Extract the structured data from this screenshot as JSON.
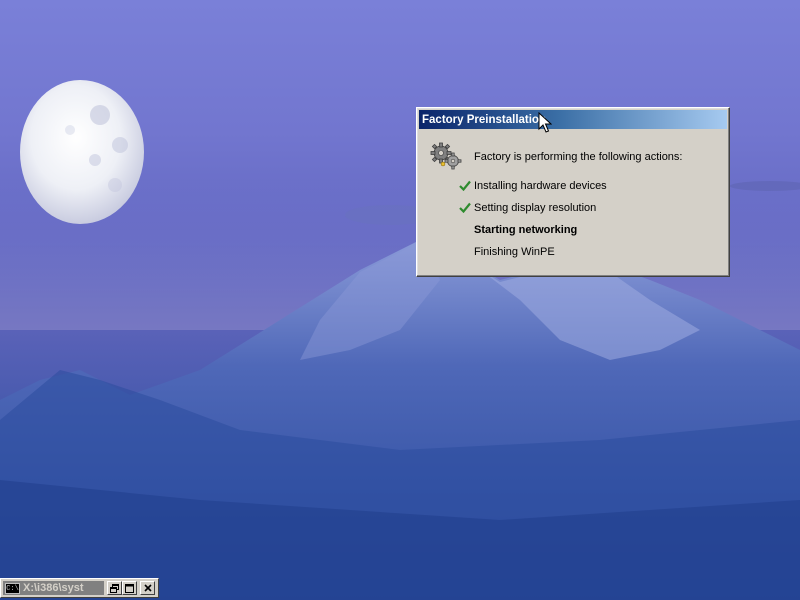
{
  "factory_dialog": {
    "title": "Factory Preinstallation",
    "header": "Factory is performing the following actions:",
    "actions": [
      {
        "label": "Installing hardware devices",
        "status": "done"
      },
      {
        "label": "Setting display resolution",
        "status": "done"
      },
      {
        "label": "Starting networking",
        "status": "active"
      },
      {
        "label": "Finishing WinPE",
        "status": "pending"
      }
    ],
    "gears_icon": "gears-icon",
    "check_icon": "check-icon",
    "check_color": "#2e8b2e"
  },
  "mini_window": {
    "title": "X:\\i386\\syst",
    "icon_text": "C:\\",
    "icon": "command-prompt-icon",
    "restore_label": "🗗",
    "maximize_label": "□",
    "close_label": "✕"
  },
  "colors": {
    "dialog_face": "#d4d0c8",
    "titlebar_active": "#0a246a",
    "titlebar_gradient_end": "#a6caf0",
    "sky": "#7276cf",
    "mountain": "#3e56a8"
  }
}
